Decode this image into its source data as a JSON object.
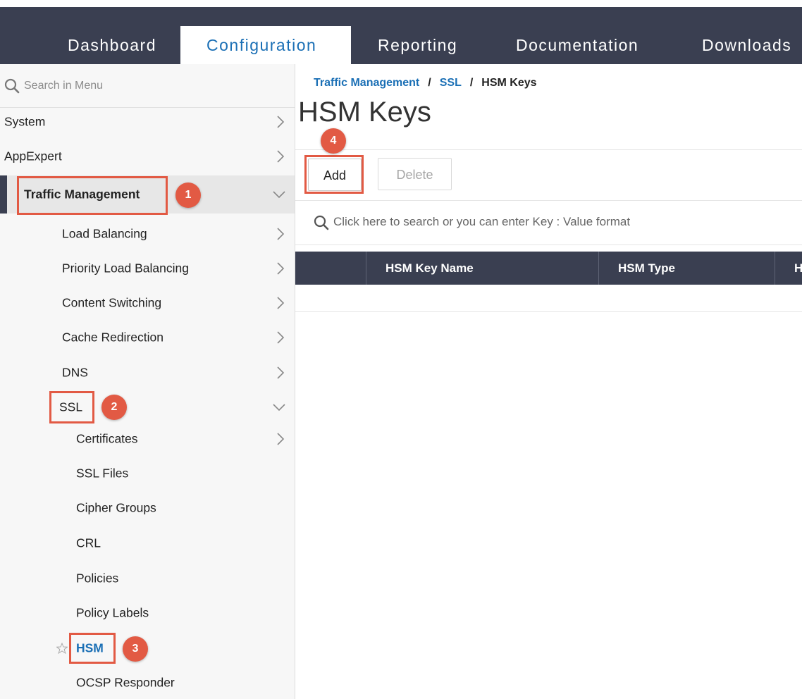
{
  "nav": {
    "tabs": [
      {
        "label": "Dashboard"
      },
      {
        "label": "Configuration"
      },
      {
        "label": "Reporting"
      },
      {
        "label": "Documentation"
      },
      {
        "label": "Downloads"
      }
    ],
    "active_tab": "Configuration"
  },
  "sidebar": {
    "search_placeholder": "Search in Menu",
    "items": [
      {
        "label": "System",
        "icon": "chevron-right-icon"
      },
      {
        "label": "AppExpert",
        "icon": "chevron-right-icon"
      },
      {
        "label": "Traffic Management",
        "icon": "chevron-down-icon"
      },
      {
        "label": "Load Balancing",
        "icon": "chevron-right-icon"
      },
      {
        "label": "Priority Load Balancing",
        "icon": "chevron-right-icon"
      },
      {
        "label": "Content Switching",
        "icon": "chevron-right-icon"
      },
      {
        "label": "Cache Redirection",
        "icon": "chevron-right-icon"
      },
      {
        "label": "DNS",
        "icon": "chevron-right-icon"
      },
      {
        "label": "SSL",
        "icon": "chevron-down-icon"
      },
      {
        "label": "Certificates",
        "icon": "chevron-right-icon"
      },
      {
        "label": "SSL Files"
      },
      {
        "label": "Cipher Groups"
      },
      {
        "label": "CRL"
      },
      {
        "label": "Policies"
      },
      {
        "label": "Policy Labels"
      },
      {
        "label": "HSM",
        "icon": "star-icon"
      },
      {
        "label": "OCSP Responder"
      }
    ]
  },
  "breadcrumb": {
    "items": [
      "Traffic Management",
      "SSL",
      "HSM Keys"
    ],
    "separator": "/"
  },
  "page": {
    "title": "HSM Keys",
    "add_label": "Add",
    "delete_label": "Delete",
    "search_placeholder": "Click here to search or you can enter Key : Value format"
  },
  "table": {
    "columns": [
      "HSM Key Name",
      "HSM Type",
      "H"
    ],
    "rows": []
  },
  "annotations": [
    "1",
    "2",
    "3",
    "4"
  ],
  "colors": {
    "nav_bg": "#3a3f51",
    "accent": "#1a6fb5",
    "callout": "#e25a44"
  }
}
